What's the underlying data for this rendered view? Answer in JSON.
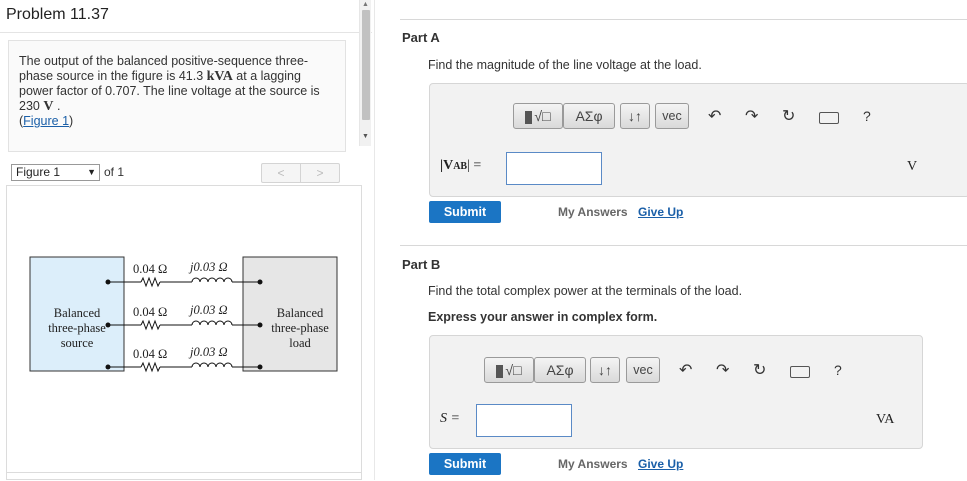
{
  "problem": {
    "title": "Problem 11.37",
    "text_1": "The output of the balanced positive-sequence three-phase source in the figure is 41.3 ",
    "text_kva": "kVA",
    "text_2": " at a lagging power factor of 0.707. The line voltage at the source is 230 ",
    "text_v": "V",
    "text_3": " .",
    "figure_link_open": "(",
    "figure_link": "Figure 1",
    "figure_link_close": ")"
  },
  "figure_toolbar": {
    "select_value": "Figure 1",
    "of_text": "of 1",
    "prev": "<",
    "next": ">"
  },
  "figure": {
    "source_label_1": "Balanced",
    "source_label_2": "three-phase",
    "source_label_3": "source",
    "load_label_1": "Balanced",
    "load_label_2": "three-phase",
    "load_label_3": "load",
    "lines": [
      {
        "r": "0.04 Ω",
        "x": "j0.03 Ω"
      },
      {
        "r": "0.04 Ω",
        "x": "j0.03 Ω"
      },
      {
        "r": "0.04 Ω",
        "x": "j0.03 Ω"
      }
    ]
  },
  "part_a": {
    "title": "Part A",
    "question": "Find the magnitude of the line voltage at the load.",
    "toolbar": {
      "sqrt": "√□",
      "greek": "ΑΣφ",
      "arrows": "↓↑",
      "vec": "vec",
      "help": "?"
    },
    "var_label": "|V",
    "var_sub": "AB",
    "var_suffix": "| =",
    "unit": "V",
    "submit": "Submit",
    "my_answers": "My Answers",
    "give_up": "Give Up"
  },
  "part_b": {
    "title": "Part B",
    "question": "Find the total complex power at the terminals of the load.",
    "instruction": "Express your answer in complex form.",
    "toolbar": {
      "sqrt": "√□",
      "greek": "ΑΣφ",
      "arrows": "↓↑",
      "vec": "vec",
      "help": "?"
    },
    "var_label": "S =",
    "unit": "VA",
    "submit": "Submit",
    "my_answers": "My Answers",
    "give_up": "Give Up"
  },
  "icons": {
    "undo": "undo-icon",
    "redo": "redo-icon",
    "reset": "reset-icon",
    "keyboard": "keyboard-icon",
    "help": "help-icon"
  },
  "colors": {
    "submit": "#1b75c4",
    "link": "#1a5fa8",
    "source_fill": "#dceefa",
    "load_fill": "#e6e6e6"
  }
}
